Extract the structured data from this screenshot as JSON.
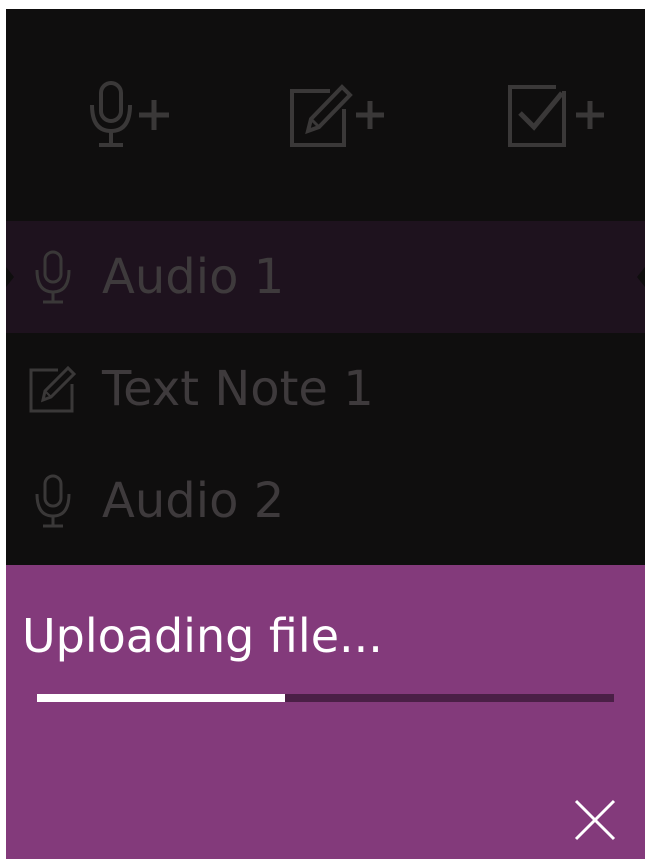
{
  "toolbar": {
    "buttons": [
      {
        "name": "add-audio-button",
        "icon": "microphone-plus-icon"
      },
      {
        "name": "add-text-note-button",
        "icon": "edit-plus-icon"
      },
      {
        "name": "add-checklist-button",
        "icon": "checkbox-plus-icon"
      }
    ]
  },
  "list": {
    "items": [
      {
        "label": "Audio 1",
        "icon": "microphone-icon",
        "selected": true
      },
      {
        "label": "Text Note 1",
        "icon": "edit-icon",
        "selected": false
      },
      {
        "label": "Audio 2",
        "icon": "microphone-icon",
        "selected": false
      }
    ]
  },
  "upload": {
    "title": "Uploading file...",
    "progress": 0.43,
    "close_icon": "close-icon"
  },
  "colors": {
    "background": "#0f0e0e",
    "selected_row": "#1e121e",
    "muted_text": "#3e3a3c",
    "accent_panel": "#833a7b",
    "progress_track": "#4a1f46",
    "progress_fill": "#ffffff"
  }
}
